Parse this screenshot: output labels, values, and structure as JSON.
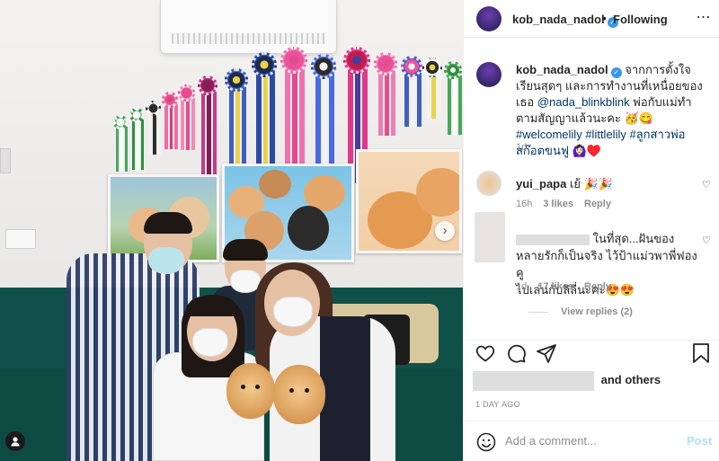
{
  "header": {
    "username": "kob_nada_nadol",
    "verified_icon": "verified-badge-icon",
    "separator": "•",
    "follow_state": "Following",
    "more_icon": "⋯"
  },
  "caption": {
    "username": "kob_nada_nadol",
    "text_1": "จากการตั้งใจเรียนสุดๆ และการทำงานที่เหนื่อยของเธอ",
    "mention": "@nada_blinkblink",
    "text_2": "พ่อกับแม่ทำตามสัญญาแล้วนะคะ 🥳😋",
    "hashtag_1": "#welcomelily",
    "hashtag_2": "#littlelily",
    "hashtag_3": "#ลูกสาวพ่อสก๊อตขนฟู",
    "emoji_tail": "🙆🏻‍♀️♥️",
    "age": "1d"
  },
  "comments": [
    {
      "username": "yui_papa",
      "text": "เย้ 🎉🎉",
      "age": "16h",
      "likes": "3 likes",
      "reply": "Reply"
    },
    {
      "username": "",
      "text_1": "ในที่สุด...ฝันของ",
      "text_2": "หลายรักก็เป็นจริง ไว้ป้าแม่วพาพี่ฟองคู",
      "text_3": "ไปเล่นกับลิลี่นะคะ😍😍",
      "age": "1d",
      "likes": "17 likes",
      "reply": "Reply",
      "view_replies": "View replies (2)"
    }
  ],
  "actions": {
    "like_icon": "heart-icon",
    "comment_icon": "comment-icon",
    "share_icon": "share-icon",
    "save_icon": "bookmark-icon",
    "likes_suffix": "and others",
    "timestamp": "1 DAY AGO"
  },
  "add_comment": {
    "placeholder": "Add a comment...",
    "post_label": "Post",
    "emoji_icon": "smiley-icon"
  },
  "photo": {
    "next_icon": "chevron-right-icon",
    "tag_icon": "person-tag-icon"
  },
  "colors": {
    "link": "#00376b",
    "verified": "#3897f0",
    "muted": "#8e8e8e",
    "post_disabled": "#b2dffc",
    "sofa": "#0f5148"
  }
}
